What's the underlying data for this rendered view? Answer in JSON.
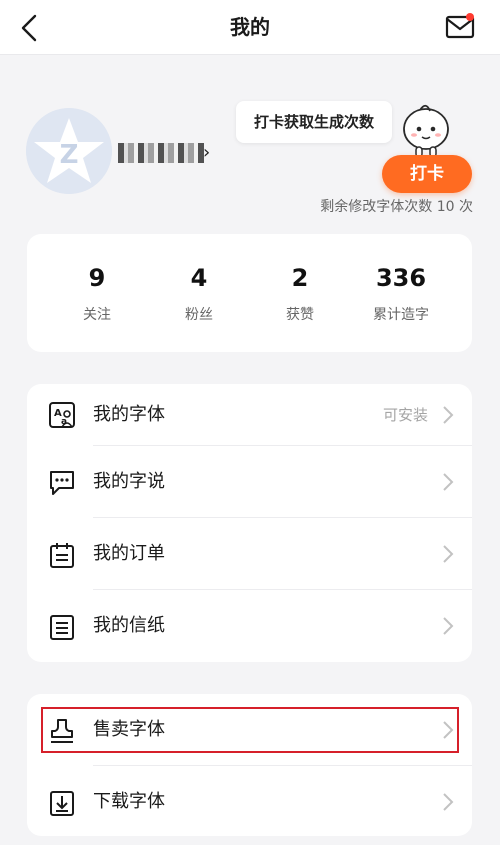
{
  "header": {
    "title": "我的"
  },
  "profile": {
    "bubble_text": "打卡获取生成次数",
    "checkin_label": "打卡",
    "remaining_text": "剩余修改字体次数 10 次"
  },
  "stats": [
    {
      "value": "9",
      "label": "关注"
    },
    {
      "value": "4",
      "label": "粉丝"
    },
    {
      "value": "2",
      "label": "获赞"
    },
    {
      "value": "336",
      "label": "累计造字"
    }
  ],
  "menu1": [
    {
      "label": "我的字体",
      "hint": "可安装",
      "icon": "font-icon"
    },
    {
      "label": "我的字说",
      "icon": "chat-bubble-icon"
    },
    {
      "label": "我的订单",
      "icon": "calendar-icon"
    },
    {
      "label": "我的信纸",
      "icon": "document-icon"
    }
  ],
  "menu2": [
    {
      "label": "售卖字体",
      "icon": "stamp-icon"
    },
    {
      "label": "下载字体",
      "icon": "download-icon"
    }
  ],
  "colors": {
    "accent": "#ff6b21",
    "highlight": "#d6202a",
    "badge": "#ff3b30"
  }
}
